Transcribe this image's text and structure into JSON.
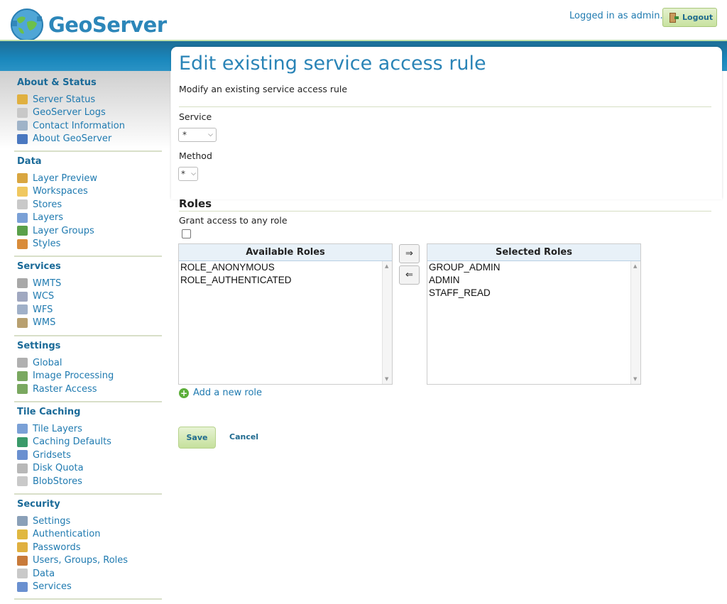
{
  "header": {
    "app_name": "GeoServer",
    "logged_in_text": "Logged in as admin.",
    "logout_label": "Logout"
  },
  "sidebar": {
    "sections": [
      {
        "title": "About & Status",
        "items": [
          {
            "label": "Server Status",
            "icon": "server-status-icon",
            "color": "#e0b040"
          },
          {
            "label": "GeoServer Logs",
            "icon": "logs-icon",
            "color": "#c8c8c8"
          },
          {
            "label": "Contact Information",
            "icon": "contact-card-icon",
            "color": "#9fb3c8"
          },
          {
            "label": "About GeoServer",
            "icon": "info-icon",
            "color": "#4a78c0"
          }
        ]
      },
      {
        "title": "Data",
        "items": [
          {
            "label": "Layer Preview",
            "icon": "layer-preview-icon",
            "color": "#d9a640"
          },
          {
            "label": "Workspaces",
            "icon": "folder-icon",
            "color": "#f0c860"
          },
          {
            "label": "Stores",
            "icon": "database-icon",
            "color": "#c9c9c9"
          },
          {
            "label": "Layers",
            "icon": "layers-icon",
            "color": "#7aa0d6"
          },
          {
            "label": "Layer Groups",
            "icon": "layer-groups-icon",
            "color": "#5aa04a"
          },
          {
            "label": "Styles",
            "icon": "palette-icon",
            "color": "#d98c3a"
          }
        ]
      },
      {
        "title": "Services",
        "items": [
          {
            "label": "WMTS",
            "icon": "wmts-service-icon",
            "color": "#a8a8a8"
          },
          {
            "label": "WCS",
            "icon": "wcs-service-icon",
            "color": "#a0a8c0"
          },
          {
            "label": "WFS",
            "icon": "wfs-service-icon",
            "color": "#a0b0c8"
          },
          {
            "label": "WMS",
            "icon": "wms-service-icon",
            "color": "#b8a070"
          }
        ]
      },
      {
        "title": "Settings",
        "items": [
          {
            "label": "Global",
            "icon": "global-settings-icon",
            "color": "#b0b0b0"
          },
          {
            "label": "Image Processing",
            "icon": "image-processing-icon",
            "color": "#7aa860"
          },
          {
            "label": "Raster Access",
            "icon": "raster-access-icon",
            "color": "#7aa860"
          }
        ]
      },
      {
        "title": "Tile Caching",
        "items": [
          {
            "label": "Tile Layers",
            "icon": "tile-layers-icon",
            "color": "#7aa0d6"
          },
          {
            "label": "Caching Defaults",
            "icon": "globe-icon",
            "color": "#3a9a6a"
          },
          {
            "label": "Gridsets",
            "icon": "grid-icon",
            "color": "#6a90d0"
          },
          {
            "label": "Disk Quota",
            "icon": "disk-icon",
            "color": "#b8b8b8"
          },
          {
            "label": "BlobStores",
            "icon": "blobstore-icon",
            "color": "#c9c9c9"
          }
        ]
      },
      {
        "title": "Security",
        "items": [
          {
            "label": "Settings",
            "icon": "wrench-icon",
            "color": "#8aa0b8"
          },
          {
            "label": "Authentication",
            "icon": "shield-icon",
            "color": "#e0b840"
          },
          {
            "label": "Passwords",
            "icon": "lock-icon",
            "color": "#e0b040"
          },
          {
            "label": "Users, Groups, Roles",
            "icon": "users-icon",
            "color": "#c87a3a"
          },
          {
            "label": "Data",
            "icon": "data-security-icon",
            "color": "#c9c9c9"
          },
          {
            "label": "Services",
            "icon": "services-security-icon",
            "color": "#6a90d0"
          }
        ]
      }
    ]
  },
  "main": {
    "title": "Edit existing service access rule",
    "description": "Modify an existing service access rule",
    "service_label": "Service",
    "service_value": "*",
    "method_label": "Method",
    "method_value": "*",
    "roles_heading": "Roles",
    "grant_any_label": "Grant access to any role",
    "grant_any_checked": false,
    "available_header": "Available Roles",
    "available_roles": [
      "ROLE_ANONYMOUS",
      "ROLE_AUTHENTICATED"
    ],
    "selected_header": "Selected Roles",
    "selected_roles": [
      "GROUP_ADMIN",
      "ADMIN",
      "STAFF_READ"
    ],
    "add_right_symbol": "⇒",
    "remove_left_symbol": "⇐",
    "add_role_label": "Add a new role",
    "save_label": "Save",
    "cancel_label": "Cancel"
  }
}
